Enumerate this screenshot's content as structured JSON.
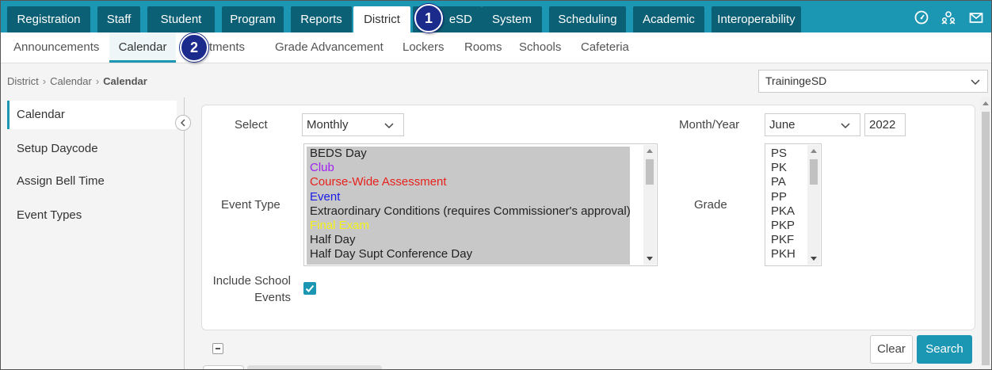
{
  "top_nav": {
    "tabs": [
      "Registration",
      "Staff",
      "Student",
      "Program",
      "Reports",
      "District",
      "eSD",
      "System",
      "Scheduling",
      "Academic",
      "Interoperability"
    ],
    "active_tab": "District",
    "icons": [
      "dashboard-icon",
      "user-group-icon",
      "mail-icon"
    ]
  },
  "sub_nav": {
    "items": [
      "Announcements",
      "Calendar",
      "rtments",
      "Grade Advancement",
      "Lockers",
      "Rooms",
      "Schools",
      "Cafeteria"
    ],
    "active_item": "Calendar"
  },
  "callouts": {
    "one": "1",
    "two": "2"
  },
  "breadcrumb": {
    "part1": "District",
    "part2": "Calendar",
    "current": "Calendar"
  },
  "school_select": {
    "value": "TrainingeSD"
  },
  "sidebar": {
    "items": [
      "Calendar",
      "Setup Daycode",
      "Assign Bell Time",
      "Event Types"
    ],
    "active": "Calendar"
  },
  "form": {
    "select_label": "Select",
    "select_value": "Monthly",
    "month_year_label": "Month/Year",
    "month_value": "June",
    "year_value": "2022",
    "event_type_label": "Event Type",
    "event_types": [
      {
        "label": "BEDS Day",
        "color": "#222222"
      },
      {
        "label": "Club",
        "color": "#a020f0"
      },
      {
        "label": "Course-Wide Assessment",
        "color": "#e8201a"
      },
      {
        "label": "Event",
        "color": "#1a1ae8"
      },
      {
        "label": "Extraordinary Conditions (requires Commissioner's approval)",
        "color": "#222222"
      },
      {
        "label": "Final Exam",
        "color": "#f2f21a"
      },
      {
        "label": "Half Day",
        "color": "#222222"
      },
      {
        "label": "Half Day Supt Conference Day",
        "color": "#222222"
      }
    ],
    "grade_label": "Grade",
    "grades": [
      "PS",
      "PK",
      "PA",
      "PP",
      "PKA",
      "PKP",
      "PKF",
      "PKH"
    ],
    "include_label_line1": "Include School",
    "include_label_line2": "Events",
    "include_checked": true
  },
  "buttons": {
    "clear": "Clear",
    "search": "Search"
  },
  "colors": {
    "brand": "#1b96b3",
    "tab_dark": "#0c6076",
    "callout": "#1a2b8c"
  }
}
